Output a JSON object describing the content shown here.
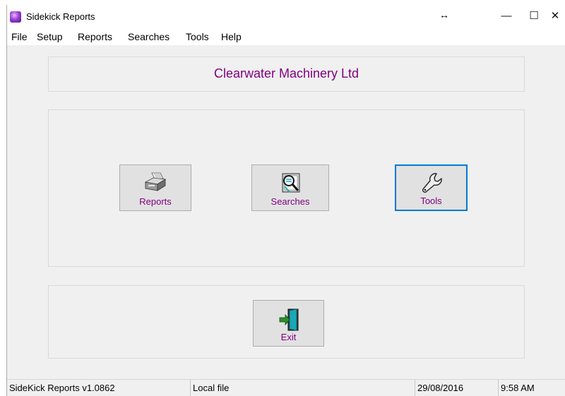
{
  "window": {
    "title": "Sidekick Reports",
    "resize_glyph": "↔",
    "minimize_glyph": "—",
    "maximize_glyph": "☐",
    "close_glyph": "✕"
  },
  "menu": {
    "items": [
      "File",
      "Setup",
      "Reports",
      "Searches",
      "Tools",
      "Help"
    ]
  },
  "header": {
    "company": "Clearwater Machinery Ltd"
  },
  "buttons": {
    "reports": {
      "label": "Reports",
      "icon": "printer-icon"
    },
    "searches": {
      "label": "Searches",
      "icon": "magnifier-icon"
    },
    "tools": {
      "label": "Tools",
      "icon": "wrench-icon"
    },
    "exit": {
      "label": "Exit",
      "icon": "exit-door-icon"
    }
  },
  "status": {
    "version": "SideKick Reports v1.0862",
    "file": "Local file",
    "date": "29/08/2016",
    "time": "9:58 AM"
  },
  "colors": {
    "accent_text": "#800080",
    "focus_border": "#0078d7"
  }
}
